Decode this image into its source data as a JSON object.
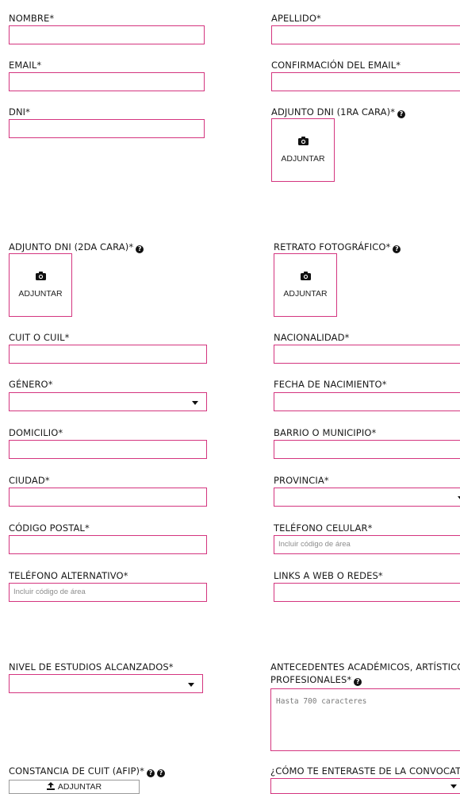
{
  "fields": {
    "nombre": {
      "label": "NOMBRE*"
    },
    "apellido": {
      "label": "APELLIDO*"
    },
    "email": {
      "label": "EMAIL*"
    },
    "confirm_email": {
      "label": "CONFIRMACIÓN DEL EMAIL*"
    },
    "dni": {
      "label": "DNI*"
    },
    "adjunto_dni_1": {
      "label": "ADJUNTO DNI (1RA CARA)*",
      "button": "ADJUNTAR"
    },
    "adjunto_dni_2": {
      "label": "ADJUNTO DNI (2DA CARA)*",
      "button": "ADJUNTAR"
    },
    "retrato": {
      "label": "RETRATO FOTOGRÁFICO*",
      "button": "ADJUNTAR"
    },
    "cuit": {
      "label": "CUIT O CUIL*"
    },
    "nacionalidad": {
      "label": "NACIONALIDAD*"
    },
    "genero": {
      "label": "GÉNERO*"
    },
    "fecha_nacimiento": {
      "label": "FECHA DE NACIMIENTO*"
    },
    "domicilio": {
      "label": "DOMICILIO*"
    },
    "barrio": {
      "label": "BARRIO O MUNICIPIO*"
    },
    "ciudad": {
      "label": "CIUDAD*"
    },
    "provincia": {
      "label": "PROVINCIA*"
    },
    "codigo_postal": {
      "label": "CÓDIGO POSTAL*"
    },
    "telefono_celular": {
      "label": "TELÉFONO CELULAR*",
      "placeholder": "Incluir código de área"
    },
    "telefono_alternativo": {
      "label": "TELÉFONO ALTERNATIVO*",
      "placeholder": "Incluir código de área"
    },
    "links": {
      "label": "LINKS A WEB O REDES*"
    },
    "nivel_estudios": {
      "label": "NIVEL DE ESTUDIOS ALCANZADOS*"
    },
    "antecedentes": {
      "label_line1": "ANTECEDENTES ACADÉMICOS, ARTÍSTICO",
      "label_line2": "PROFESIONALES*",
      "placeholder": "Hasta 700 caracteres"
    },
    "constancia_cuit": {
      "label": "CONSTANCIA DE CUIT (AFIP)*",
      "button": "ADJUNTAR"
    },
    "como_enteraste": {
      "label": "¿CÓMO TE ENTERASTE DE LA CONVOCAT"
    }
  },
  "icons": {
    "help": "question-circle-icon",
    "camera": "camera-icon",
    "upload": "upload-icon"
  },
  "colors": {
    "field_border": "#d4357f"
  }
}
